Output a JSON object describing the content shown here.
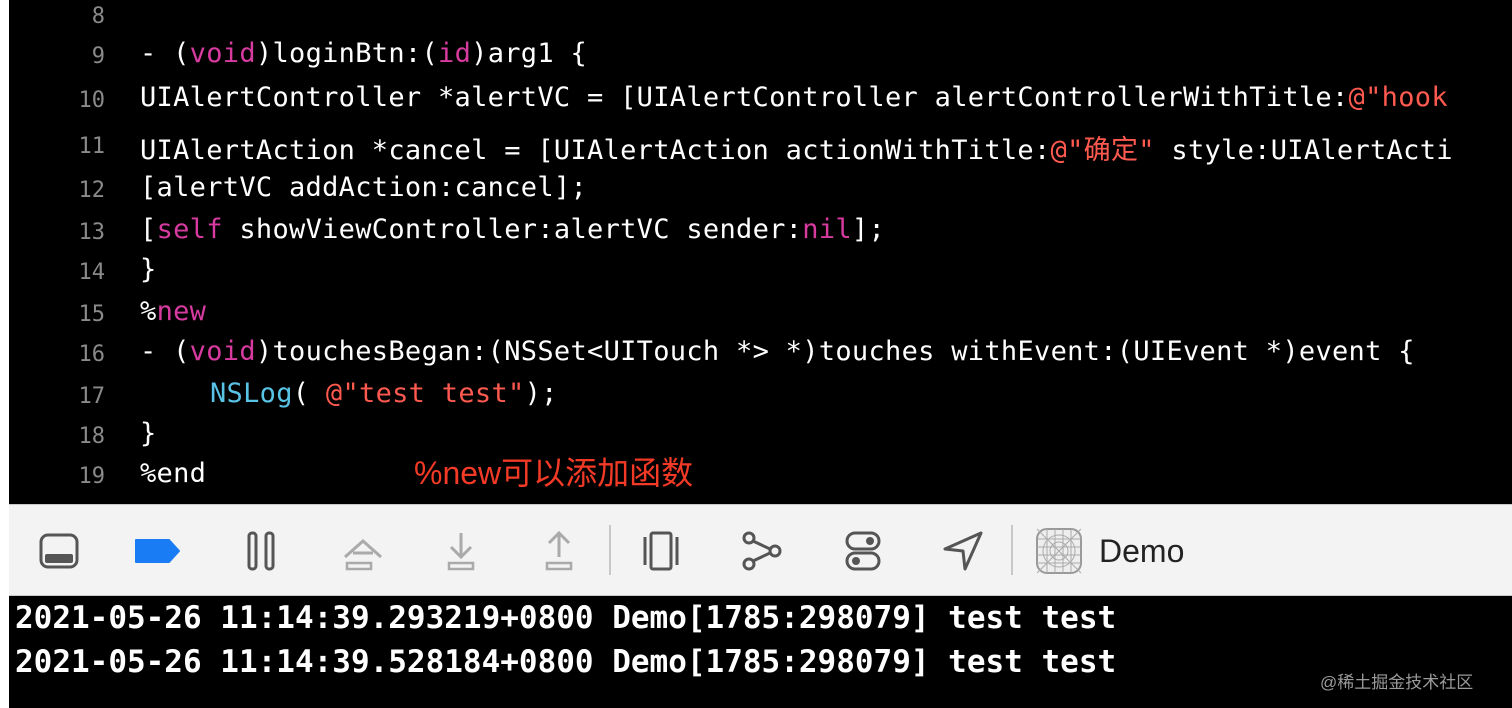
{
  "editor": {
    "lines": [
      {
        "num": "8",
        "text": ""
      },
      {
        "num": "9",
        "text": "- (void)loginBtn:(id)arg1 {"
      },
      {
        "num": "10",
        "text": "UIAlertController *alertVC = [UIAlertController alertControllerWithTitle:@\"hook"
      },
      {
        "num": "11",
        "text": "UIAlertAction *cancel = [UIAlertAction actionWithTitle:@\"确定\" style:UIAlertActi"
      },
      {
        "num": "12",
        "text": "[alertVC addAction:cancel];"
      },
      {
        "num": "13",
        "text": "[self showViewController:alertVC sender:nil];"
      },
      {
        "num": "14",
        "text": "}"
      },
      {
        "num": "15",
        "text": "%new"
      },
      {
        "num": "16",
        "text": "- (void)touchesBegan:(NSSet<UITouch *> *)touches withEvent:(UIEvent *)event {"
      },
      {
        "num": "17",
        "text": "NSLog( @\"test test\");"
      },
      {
        "num": "18",
        "text": "}"
      },
      {
        "num": "19",
        "text": "%end"
      }
    ],
    "annotation": "%new可以添加函数"
  },
  "toolbar": {
    "icons": [
      "hide-debug-area-icon",
      "breakpoints-toggle-icon",
      "pause-icon",
      "step-over-icon",
      "step-into-icon",
      "step-out-icon",
      "view-hierarchy-icon",
      "memory-graph-icon",
      "environment-overrides-icon",
      "simulate-location-icon",
      "app-icon"
    ],
    "scheme_name": "Demo"
  },
  "console": {
    "lines": [
      "2021-05-26 11:14:39.293219+0800 Demo[1785:298079] test test",
      "2021-05-26 11:14:39.528184+0800 Demo[1785:298079] test test"
    ]
  },
  "watermark": "@稀土掘金技术社区",
  "colors": {
    "keyword": "#d83ba0",
    "string": "#ff5a4f",
    "function": "#59c3e6",
    "annotation": "#f23a26",
    "breakpoint_active": "#1a7cf5"
  }
}
